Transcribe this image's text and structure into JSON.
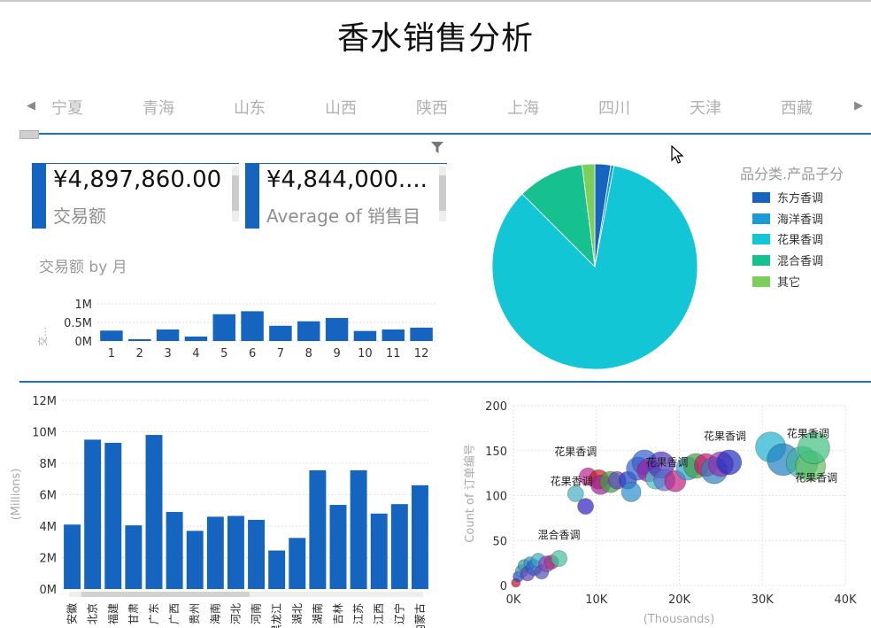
{
  "title": "香水销售分析",
  "slicer": {
    "provinces": [
      "宁夏",
      "青海",
      "山东",
      "山西",
      "陕西",
      "上海",
      "四川",
      "天津",
      "西藏"
    ],
    "left_arrow": "◀",
    "right_arrow": "▶"
  },
  "cards": [
    {
      "value": "¥4,897,860.00",
      "label": "交易额"
    },
    {
      "value": "¥4,844,000....",
      "label": "Average of 销售目"
    }
  ],
  "monthly": {
    "subtitle": "交易额 by 月",
    "ylabel": "交...",
    "chart_data": {
      "type": "bar",
      "categories": [
        "1",
        "2",
        "3",
        "4",
        "5",
        "6",
        "7",
        "8",
        "9",
        "10",
        "11",
        "12"
      ],
      "values": [
        0.28,
        0.05,
        0.31,
        0.12,
        0.72,
        0.8,
        0.41,
        0.53,
        0.62,
        0.27,
        0.31,
        0.36
      ],
      "unit": "M",
      "ylim": [
        0,
        1
      ],
      "yticks": [
        "0M",
        "0.5M",
        "1M"
      ],
      "color": "#1565c0"
    }
  },
  "pie": {
    "legend_title": "品分类.产品子分",
    "chart_data": {
      "type": "pie",
      "labels": [
        "东方香调",
        "海洋香调",
        "花果香调",
        "混合香调",
        "其它"
      ],
      "values": [
        2.5,
        0.5,
        84.5,
        10.5,
        2.0
      ],
      "colors": [
        "#1565c0",
        "#1a9ad6",
        "#13c6d6",
        "#16c08f",
        "#7ccf5a"
      ]
    }
  },
  "province_bar": {
    "ylabel": "(Millions)",
    "chart_data": {
      "type": "bar",
      "categories": [
        "安徽",
        "北京",
        "福建",
        "甘肃",
        "广东",
        "广西",
        "贵州",
        "海南",
        "河北",
        "河南",
        "黑龙江",
        "湖北",
        "湖南",
        "吉林",
        "江苏",
        "江西",
        "辽宁",
        "内蒙古"
      ],
      "values": [
        4.1,
        9.5,
        9.3,
        4.05,
        9.8,
        4.9,
        3.7,
        4.6,
        4.65,
        4.4,
        2.45,
        3.25,
        7.55,
        5.35,
        7.55,
        4.8,
        5.4,
        6.6
      ],
      "ylim": [
        0,
        12
      ],
      "yticks": [
        "0M",
        "2M",
        "4M",
        "6M",
        "8M",
        "10M",
        "12M"
      ],
      "color": "#1565c0"
    }
  },
  "scatter": {
    "xlabel": "(Thousands)",
    "ylabel": "Count of 订单编号",
    "chart_data": {
      "type": "scatter",
      "xlim": [
        0,
        40
      ],
      "ylim": [
        0,
        200
      ],
      "xticks": [
        "0K",
        "10K",
        "20K",
        "30K",
        "40K"
      ],
      "yticks": [
        "0",
        "50",
        "100",
        "150",
        "200"
      ],
      "annotations": [
        {
          "text": "花果香调",
          "x": 7.5,
          "y": 145
        },
        {
          "text": "花果香调",
          "x": 7.0,
          "y": 112
        },
        {
          "text": "花果香调",
          "x": 18.5,
          "y": 133
        },
        {
          "text": "花果香调",
          "x": 25.5,
          "y": 162
        },
        {
          "text": "花果香调",
          "x": 35.5,
          "y": 165
        },
        {
          "text": "花果香调",
          "x": 36.5,
          "y": 116
        },
        {
          "text": "混合香调",
          "x": 5.5,
          "y": 52
        }
      ],
      "points": [
        {
          "x": 0.3,
          "y": 3,
          "s": 5,
          "c": "#c01030"
        },
        {
          "x": 0.6,
          "y": 10,
          "s": 6,
          "c": "#2050c0"
        },
        {
          "x": 1.0,
          "y": 16,
          "s": 7,
          "c": "#4090c0"
        },
        {
          "x": 1.3,
          "y": 22,
          "s": 7,
          "c": "#30a0a0"
        },
        {
          "x": 1.7,
          "y": 13,
          "s": 8,
          "c": "#6040c0"
        },
        {
          "x": 2.0,
          "y": 25,
          "s": 7,
          "c": "#2a8fcf"
        },
        {
          "x": 2.5,
          "y": 20,
          "s": 9,
          "c": "#3060c0"
        },
        {
          "x": 3.0,
          "y": 28,
          "s": 8,
          "c": "#30b0c0"
        },
        {
          "x": 3.4,
          "y": 15,
          "s": 8,
          "c": "#5050b0"
        },
        {
          "x": 4.0,
          "y": 24,
          "s": 9,
          "c": "#9040c0"
        },
        {
          "x": 4.6,
          "y": 26,
          "s": 8,
          "c": "#a03070"
        },
        {
          "x": 5.5,
          "y": 30,
          "s": 9,
          "c": "#40c0a0"
        },
        {
          "x": 7.5,
          "y": 102,
          "s": 9,
          "c": "#40b0c0"
        },
        {
          "x": 8.7,
          "y": 88,
          "s": 9,
          "c": "#3020c0"
        },
        {
          "x": 9.0,
          "y": 121,
          "s": 10,
          "c": "#c02090"
        },
        {
          "x": 10.3,
          "y": 118,
          "s": 11,
          "c": "#c02020"
        },
        {
          "x": 10.5,
          "y": 112,
          "s": 11,
          "c": "#a020a0"
        },
        {
          "x": 11.7,
          "y": 115,
          "s": 12,
          "c": "#40a040"
        },
        {
          "x": 12.5,
          "y": 117,
          "s": 10,
          "c": "#6040c0"
        },
        {
          "x": 13.8,
          "y": 117,
          "s": 10,
          "c": "#2040c0"
        },
        {
          "x": 14.2,
          "y": 104,
          "s": 11,
          "c": "#2a8fcf"
        },
        {
          "x": 15.0,
          "y": 130,
          "s": 13,
          "c": "#3060d0"
        },
        {
          "x": 15.8,
          "y": 137,
          "s": 14,
          "c": "#3060d0"
        },
        {
          "x": 16.3,
          "y": 128,
          "s": 13,
          "c": "#a020a0"
        },
        {
          "x": 17.2,
          "y": 119,
          "s": 12,
          "c": "#40c0c0"
        },
        {
          "x": 17.8,
          "y": 134,
          "s": 15,
          "c": "#5030c0"
        },
        {
          "x": 18.2,
          "y": 117,
          "s": 12,
          "c": "#6070d0"
        },
        {
          "x": 19.5,
          "y": 116,
          "s": 12,
          "c": "#c02080"
        },
        {
          "x": 21.0,
          "y": 130,
          "s": 13,
          "c": "#2a9fcf"
        },
        {
          "x": 22.0,
          "y": 133,
          "s": 14,
          "c": "#40a040"
        },
        {
          "x": 23.2,
          "y": 134,
          "s": 13,
          "c": "#d01070"
        },
        {
          "x": 24.2,
          "y": 128,
          "s": 15,
          "c": "#3080c0"
        },
        {
          "x": 25.0,
          "y": 135,
          "s": 14,
          "c": "#9030b0"
        },
        {
          "x": 26.0,
          "y": 137,
          "s": 14,
          "c": "#2030c0"
        },
        {
          "x": 31.0,
          "y": 154,
          "s": 17,
          "c": "#20b0d0"
        },
        {
          "x": 32.5,
          "y": 140,
          "s": 18,
          "c": "#2080c0"
        },
        {
          "x": 34.8,
          "y": 137,
          "s": 18,
          "c": "#40b0a0"
        },
        {
          "x": 35.8,
          "y": 133,
          "s": 17,
          "c": "#60c060"
        },
        {
          "x": 36.2,
          "y": 153,
          "s": 18,
          "c": "#40c080"
        }
      ]
    }
  }
}
